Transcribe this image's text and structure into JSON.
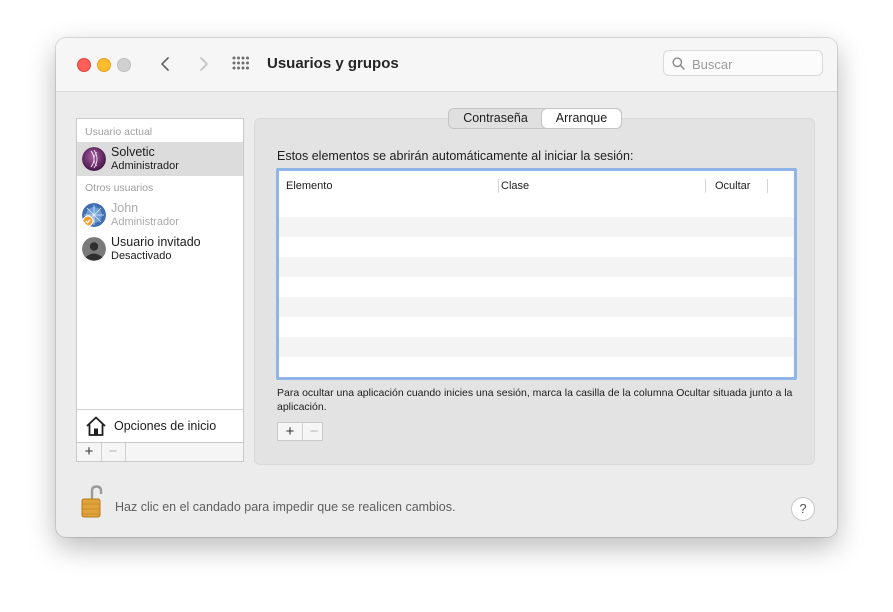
{
  "window": {
    "title": "Usuarios y grupos",
    "search_placeholder": "Buscar"
  },
  "sidebar": {
    "current_user_header": "Usuario actual",
    "other_users_header": "Otros usuarios",
    "users": [
      {
        "name": "Solvetic",
        "role": "Administrador",
        "selected": true,
        "dimmed": false
      },
      {
        "name": "John",
        "role": "Administrador",
        "selected": false,
        "dimmed": true
      },
      {
        "name": "Usuario invitado",
        "role": "Desactivado",
        "selected": false,
        "dimmed": false
      }
    ],
    "login_options": "Opciones de inicio",
    "add_symbol": "+",
    "remove_symbol": "−"
  },
  "tabs": [
    {
      "label": "Contraseña",
      "selected": false
    },
    {
      "label": "Arranque",
      "selected": true
    }
  ],
  "startup": {
    "description": "Estos elementos se abrirán automáticamente al iniciar la sesión:",
    "columns": [
      "Elemento",
      "Clase",
      "Ocultar"
    ],
    "rows": [],
    "help": "Para ocultar una aplicación cuando inicies una sesión, marca la casilla de la columna Ocultar situada junto a la aplicación.",
    "add_symbol": "+",
    "remove_symbol": "−"
  },
  "footer": {
    "lock_text": "Haz clic en el candado para impedir que se realicen cambios.",
    "help_symbol": "?"
  },
  "colors": {
    "selection_bg": "#dcdcdc",
    "table_focus_border": "#8fb4e8",
    "stripe": "#f4f4f4",
    "close": "#fe5f57",
    "minimize": "#febc2e"
  }
}
